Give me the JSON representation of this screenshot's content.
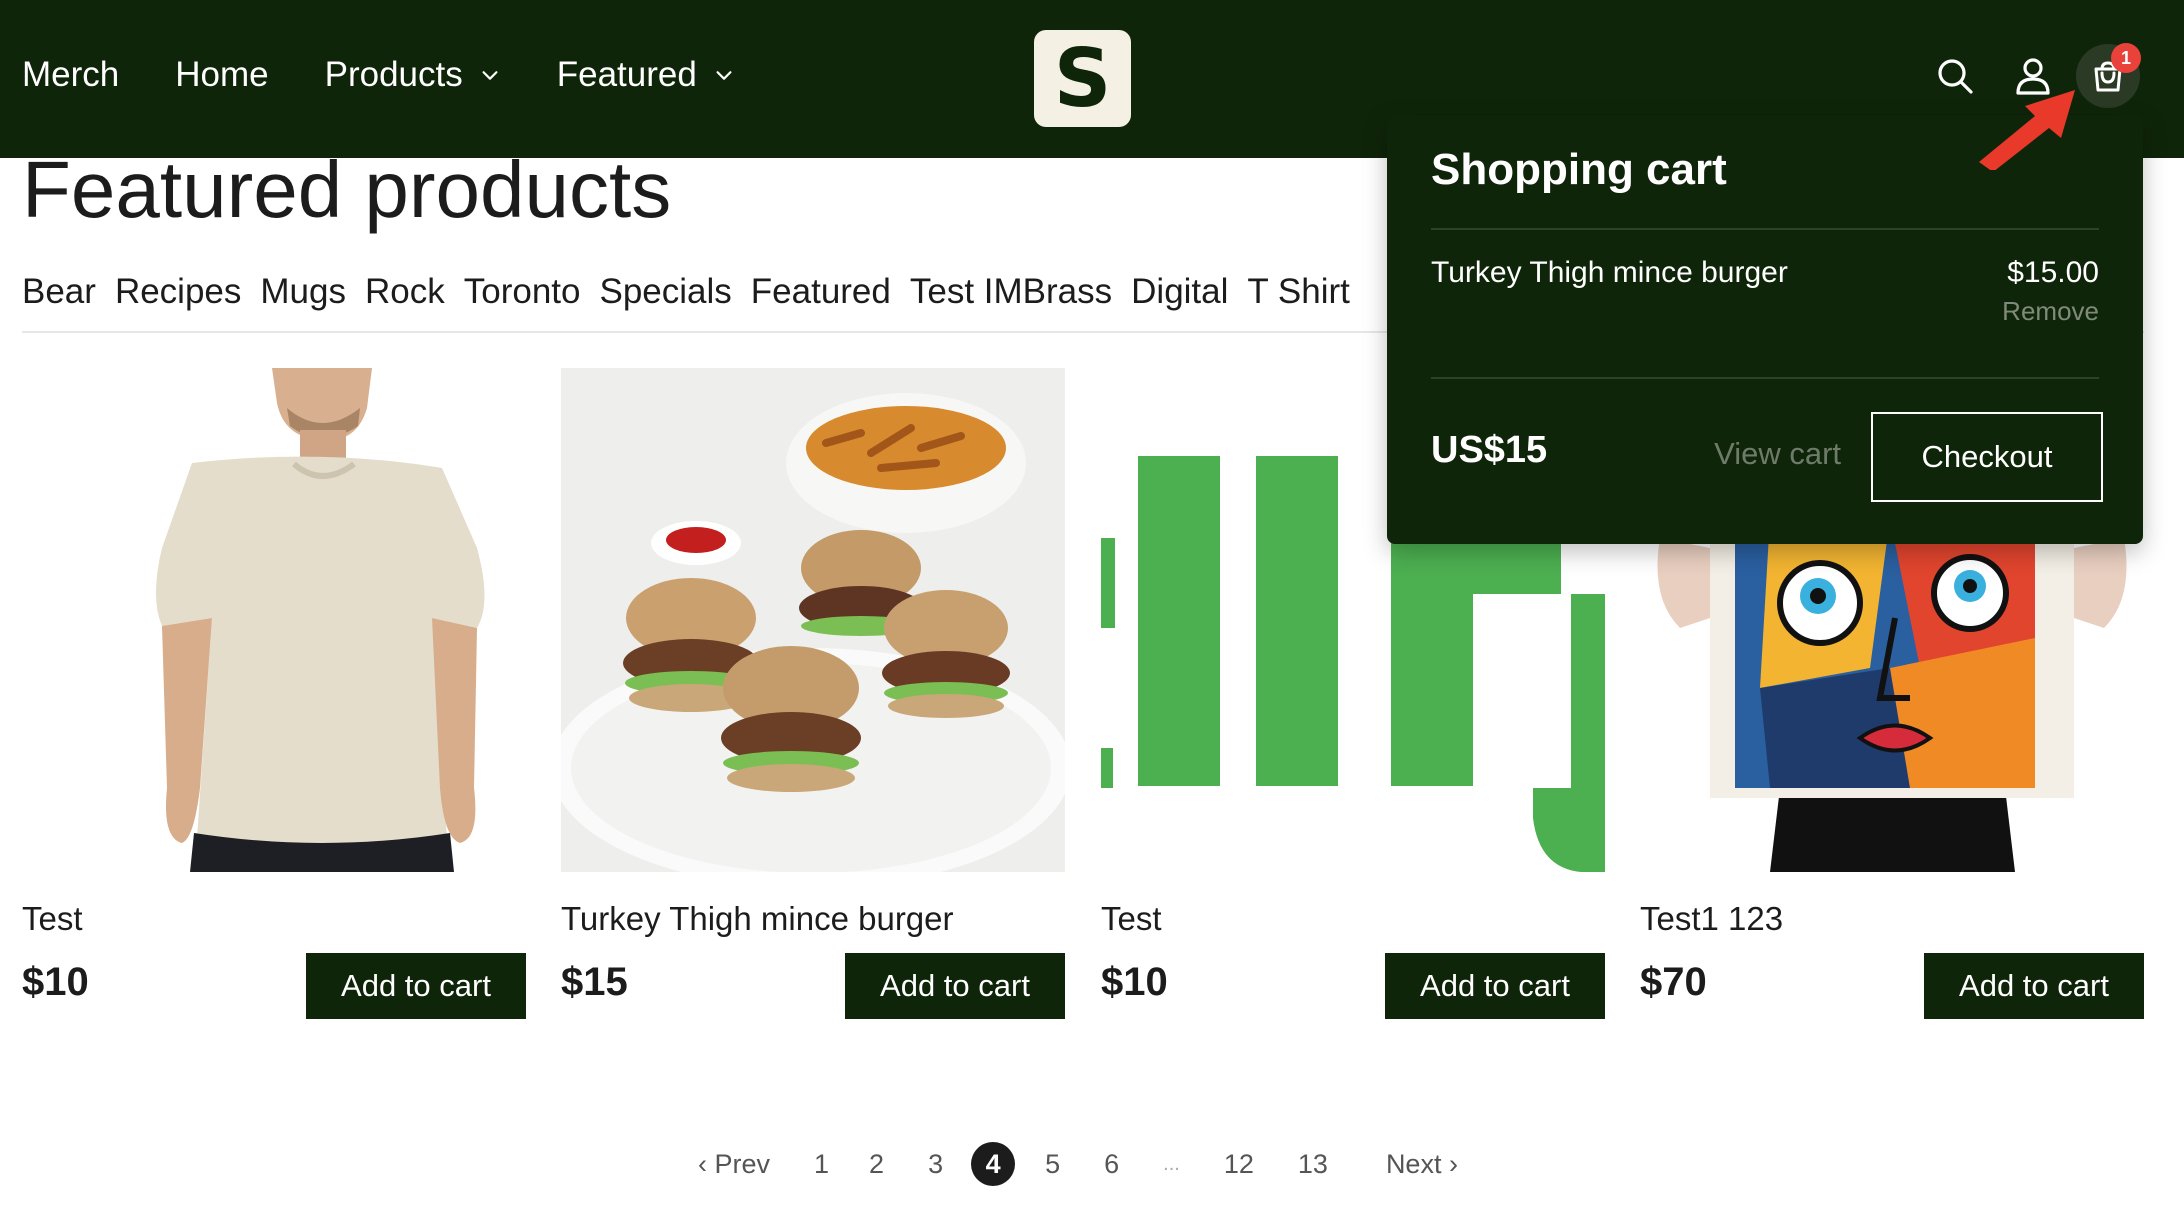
{
  "header": {
    "nav": [
      {
        "label": "Merch",
        "dropdown": false
      },
      {
        "label": "Home",
        "dropdown": false
      },
      {
        "label": "Products",
        "dropdown": true
      },
      {
        "label": "Featured",
        "dropdown": true
      }
    ],
    "logo_letter": "S",
    "cart_count": "1",
    "icons": [
      "search-icon",
      "account-icon",
      "cart-icon"
    ]
  },
  "main": {
    "title": "Featured products",
    "categories": [
      "Bear",
      "Recipes",
      "Mugs",
      "Rock",
      "Toronto",
      "Specials",
      "Featured",
      "Test IMBrass",
      "Digital",
      "T Shirt"
    ],
    "products": [
      {
        "name": "Test",
        "price": "$10",
        "button": "Add to cart",
        "image": "t-shirt-model"
      },
      {
        "name": "Turkey Thigh mince burger",
        "price": "$15",
        "button": "Add to cart",
        "image": "burgers-photo"
      },
      {
        "name": "Test",
        "price": "$10",
        "button": "Add to cart",
        "image": "green-lettering"
      },
      {
        "name": "Test1 123",
        "price": "$70",
        "button": "Add to cart",
        "image": "abstract-face-poster"
      }
    ]
  },
  "pagination": {
    "prev": "‹ Prev",
    "pages": [
      "1",
      "2",
      "3",
      "4",
      "5",
      "6",
      "...",
      "12",
      "13"
    ],
    "current": "4",
    "next": "Next ›"
  },
  "cart_dropdown": {
    "title": "Shopping cart",
    "item_name": "Turkey Thigh mince burger",
    "item_price": "$15.00",
    "remove_label": "Remove",
    "total": "US$15",
    "view_cart_label": "View cart",
    "checkout_label": "Checkout"
  },
  "colors": {
    "header_bg": "#0f2509",
    "button_bg": "#0f2509",
    "badge": "#e8423a",
    "annotation_arrow": "#e8392a"
  }
}
